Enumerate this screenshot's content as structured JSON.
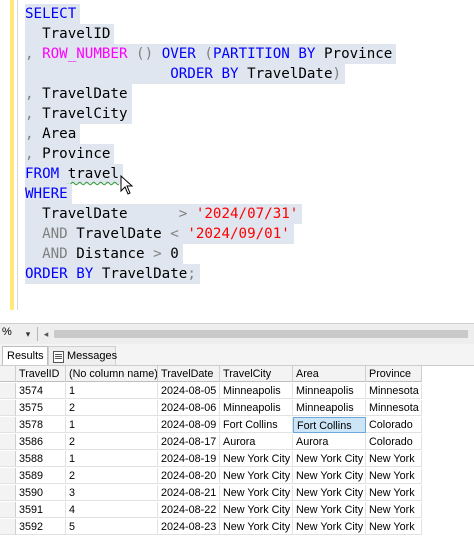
{
  "editor": {
    "lines": [
      [
        {
          "t": "SELECT",
          "c": "kw"
        }
      ],
      [
        {
          "t": "  TravelID",
          "c": "plain"
        }
      ],
      [
        {
          "t": ", ",
          "c": "gray"
        },
        {
          "t": "ROW_NUMBER",
          "c": "fn"
        },
        {
          "t": " () ",
          "c": "gray"
        },
        {
          "t": "OVER",
          "c": "kw"
        },
        {
          "t": " (",
          "c": "gray"
        },
        {
          "t": "PARTITION BY",
          "c": "kw"
        },
        {
          "t": " Province",
          "c": "plain"
        }
      ],
      [
        {
          "t": "                 ",
          "c": "plain"
        },
        {
          "t": "ORDER BY",
          "c": "kw"
        },
        {
          "t": " TravelDate",
          "c": "plain"
        },
        {
          "t": ")",
          "c": "gray"
        }
      ],
      [
        {
          "t": ", ",
          "c": "gray"
        },
        {
          "t": "TravelDate",
          "c": "plain"
        }
      ],
      [
        {
          "t": ", ",
          "c": "gray"
        },
        {
          "t": "TravelCity",
          "c": "plain"
        }
      ],
      [
        {
          "t": ", ",
          "c": "gray"
        },
        {
          "t": "Area",
          "c": "plain"
        }
      ],
      [
        {
          "t": ", ",
          "c": "gray"
        },
        {
          "t": "Province",
          "c": "plain"
        }
      ],
      [
        {
          "t": "FROM",
          "c": "kw"
        },
        {
          "t": " ",
          "c": "plain"
        },
        {
          "t": "travel",
          "c": "plain squiggle"
        }
      ],
      [
        {
          "t": "WHERE",
          "c": "kw"
        }
      ],
      [
        {
          "t": "  TravelDate      ",
          "c": "plain"
        },
        {
          "t": ">",
          "c": "gray"
        },
        {
          "t": " ",
          "c": "plain"
        },
        {
          "t": "'2024/07/31'",
          "c": "str"
        }
      ],
      [
        {
          "t": "  ",
          "c": "plain"
        },
        {
          "t": "AND",
          "c": "gray"
        },
        {
          "t": " TravelDate ",
          "c": "plain"
        },
        {
          "t": "<",
          "c": "gray"
        },
        {
          "t": " ",
          "c": "plain"
        },
        {
          "t": "'2024/09/01'",
          "c": "str"
        }
      ],
      [
        {
          "t": "  ",
          "c": "plain"
        },
        {
          "t": "AND",
          "c": "gray"
        },
        {
          "t": " Distance ",
          "c": "plain"
        },
        {
          "t": ">",
          "c": "gray"
        },
        {
          "t": " 0",
          "c": "plain"
        }
      ],
      [
        {
          "t": "ORDER BY",
          "c": "kw"
        },
        {
          "t": " TravelDate",
          "c": "plain"
        },
        {
          "t": ";",
          "c": "gray"
        }
      ]
    ],
    "cursor_icon": "mouse-pointer-icon"
  },
  "status": {
    "zoom": "%",
    "zoom_dropdown_icon": "▾",
    "scroll_left_icon": "◂"
  },
  "tabs": {
    "results": "Results",
    "messages": "Messages"
  },
  "grid": {
    "columns": [
      "TravelID",
      "(No column name)",
      "TravelDate",
      "TravelCity",
      "Area",
      "Province"
    ],
    "rows": [
      [
        "3574",
        "1",
        "2024-08-05",
        "Minneapolis",
        "Minneapolis",
        "Minnesota"
      ],
      [
        "3575",
        "2",
        "2024-08-06",
        "Minneapolis",
        "Minneapolis",
        "Minnesota"
      ],
      [
        "3578",
        "1",
        "2024-08-09",
        "Fort Collins",
        "Fort Collins",
        "Colorado"
      ],
      [
        "3586",
        "2",
        "2024-08-17",
        "Aurora",
        "Aurora",
        "Colorado"
      ],
      [
        "3588",
        "1",
        "2024-08-19",
        "New York City",
        "New York City",
        "New York"
      ],
      [
        "3589",
        "2",
        "2024-08-20",
        "New York City",
        "New York City",
        "New York"
      ],
      [
        "3590",
        "3",
        "2024-08-21",
        "New York City",
        "New York City",
        "New York"
      ],
      [
        "3591",
        "4",
        "2024-08-22",
        "New York City",
        "New York City",
        "New York"
      ],
      [
        "3592",
        "5",
        "2024-08-23",
        "New York City",
        "New York City",
        "New York"
      ]
    ],
    "selected_cell": {
      "row": 2,
      "col": 4
    }
  }
}
